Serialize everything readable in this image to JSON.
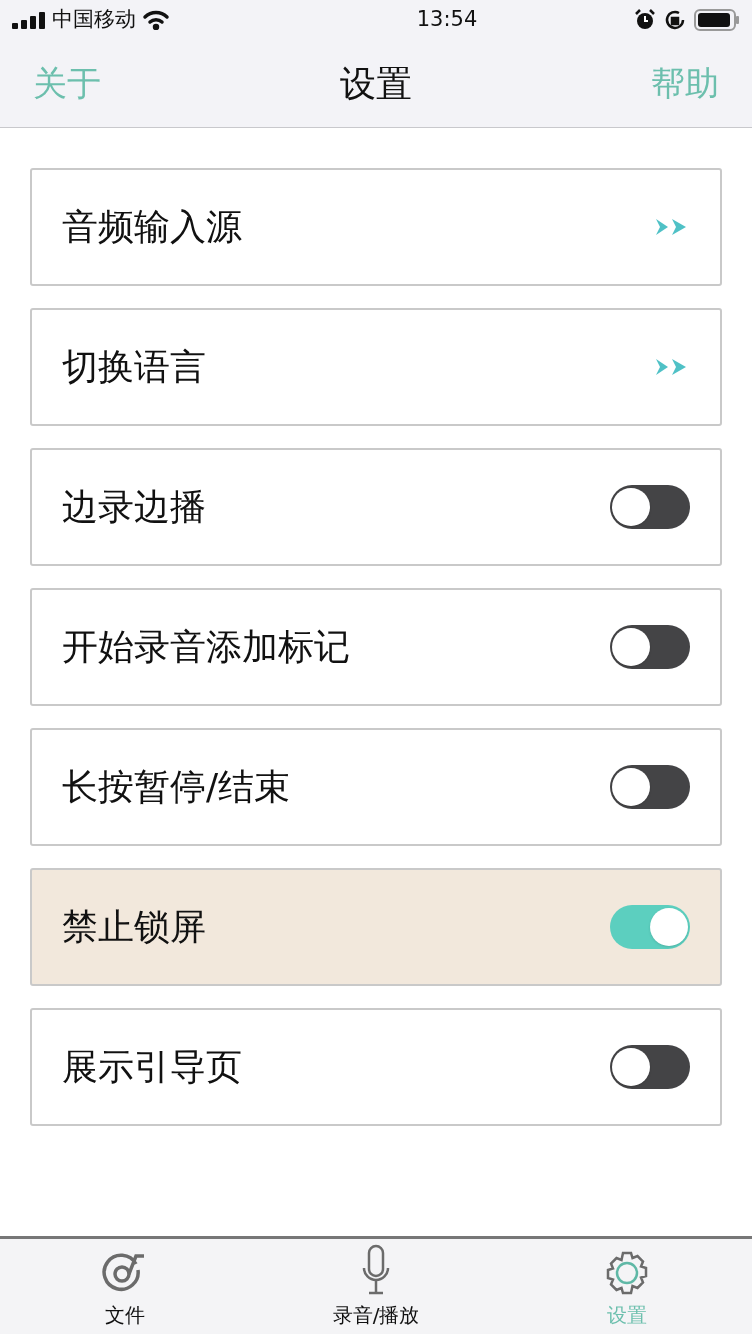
{
  "status_bar": {
    "carrier": "中国移动",
    "time": "13:54"
  },
  "nav": {
    "left": "关于",
    "title": "设置",
    "right": "帮助"
  },
  "rows": [
    {
      "kind": "link",
      "label": "音频输入源"
    },
    {
      "kind": "link",
      "label": "切换语言"
    },
    {
      "kind": "toggle",
      "label": "边录边播",
      "on": false
    },
    {
      "kind": "toggle",
      "label": "开始录音添加标记",
      "on": false
    },
    {
      "kind": "toggle",
      "label": "长按暂停/结束",
      "on": false
    },
    {
      "kind": "toggle",
      "label": "禁止锁屏",
      "on": true
    },
    {
      "kind": "toggle",
      "label": "展示引导页",
      "on": false
    }
  ],
  "tabs": [
    {
      "kind": "files",
      "label": "文件",
      "selected": false
    },
    {
      "kind": "mic",
      "label": "录音/播放",
      "selected": false
    },
    {
      "kind": "gear",
      "label": "设置",
      "selected": true
    }
  ]
}
